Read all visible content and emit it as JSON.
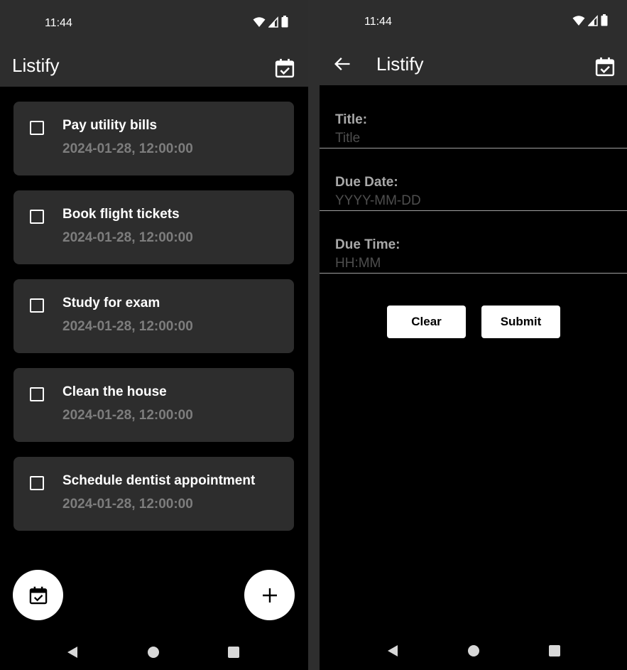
{
  "left_screen": {
    "status": {
      "time": "11:44"
    },
    "appbar": {
      "title": "Listify",
      "action_icon": "calendar-check-icon"
    },
    "tasks": [
      {
        "title": "Pay utility bills",
        "due": "2024-01-28, 12:00:00",
        "checked": false
      },
      {
        "title": "Book flight tickets",
        "due": "2024-01-28, 12:00:00",
        "checked": false
      },
      {
        "title": "Study for exam",
        "due": "2024-01-28, 12:00:00",
        "checked": false
      },
      {
        "title": "Clean the house",
        "due": "2024-01-28, 12:00:00",
        "checked": false
      },
      {
        "title": "Schedule dentist appointment",
        "due": "2024-01-28, 12:00:00",
        "checked": false
      }
    ],
    "fabs": {
      "left_icon": "calendar-check-icon",
      "right_icon": "plus-icon"
    }
  },
  "right_screen": {
    "status": {
      "time": "11:44"
    },
    "appbar": {
      "title": "Listify",
      "nav_icon": "arrow-back-icon",
      "action_icon": "calendar-check-icon"
    },
    "form": {
      "title_label": "Title:",
      "title_placeholder": "Title",
      "title_value": "",
      "date_label": "Due Date:",
      "date_placeholder": "YYYY-MM-DD",
      "date_value": "",
      "time_label": "Due Time:",
      "time_placeholder": "HH:MM",
      "time_value": ""
    },
    "buttons": {
      "clear": "Clear",
      "submit": "Submit"
    }
  },
  "colors": {
    "bar_background": "#2d2d2d",
    "screen_background": "#000000",
    "card_background": "#2d2d2d",
    "muted_text": "#7d7d7d",
    "button_background": "#ffffff"
  }
}
